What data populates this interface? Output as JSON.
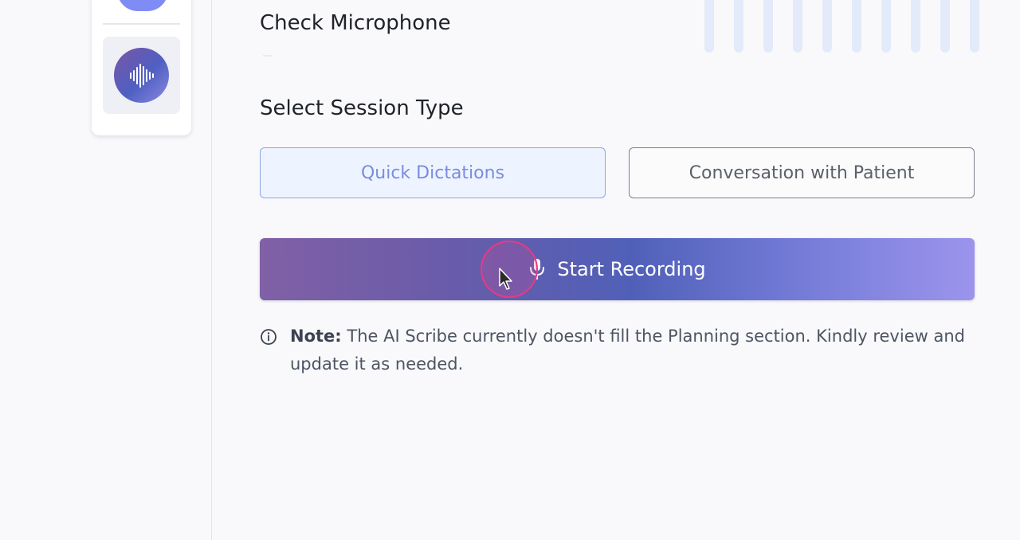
{
  "sidebar": {
    "scribe_button_icon": "soundwave-icon"
  },
  "microphone": {
    "title": "Check Microphone",
    "level_bars": 10
  },
  "session": {
    "title": "Select Session Type",
    "options": [
      {
        "label": "Quick Dictations",
        "selected": true
      },
      {
        "label": "Conversation with Patient",
        "selected": false
      }
    ]
  },
  "record": {
    "label": "Start Recording",
    "icon": "microphone-icon"
  },
  "note": {
    "icon": "info-icon",
    "label": "Note:",
    "text": " The AI Scribe currently doesn't fill the Planning section. Kindly review and update it as needed."
  },
  "colors": {
    "accent": "#7a8ce0",
    "record_gradient_start": "#8060a6",
    "record_gradient_end": "#9c94ec",
    "cursor_ring": "#e83a84"
  }
}
